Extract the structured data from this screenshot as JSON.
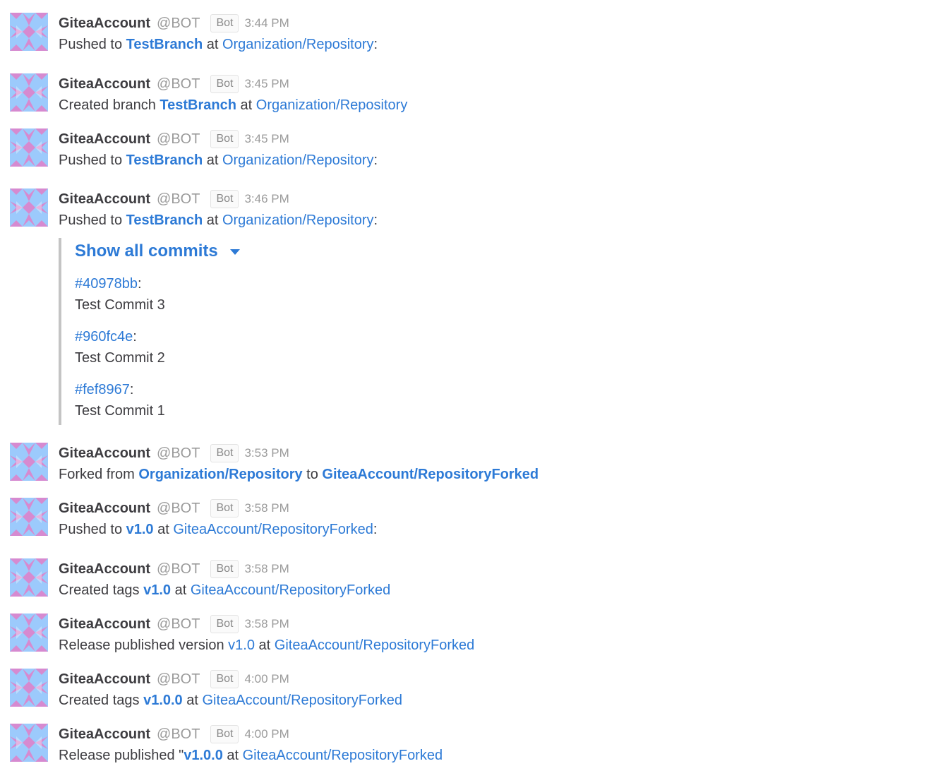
{
  "messages": [
    {
      "username": "GiteaAccount",
      "handle": "@BOT",
      "badge": "Bot",
      "time": "3:44 PM",
      "parts": [
        {
          "t": "Pushed to "
        },
        {
          "t": "TestBranch",
          "link": true,
          "bold": true
        },
        {
          "t": " at "
        },
        {
          "t": "Organization/Repository",
          "link": true
        },
        {
          "t": ":"
        }
      ]
    },
    {
      "username": "GiteaAccount",
      "handle": "@BOT",
      "badge": "Bot",
      "time": "3:45 PM",
      "parts": [
        {
          "t": "Created branch "
        },
        {
          "t": "TestBranch",
          "link": true,
          "bold": true
        },
        {
          "t": " at "
        },
        {
          "t": "Organization/Repository",
          "link": true
        }
      ]
    },
    {
      "username": "GiteaAccount",
      "handle": "@BOT",
      "badge": "Bot",
      "time": "3:45 PM",
      "parts": [
        {
          "t": "Pushed to "
        },
        {
          "t": "TestBranch",
          "link": true,
          "bold": true
        },
        {
          "t": " at "
        },
        {
          "t": "Organization/Repository",
          "link": true
        },
        {
          "t": ":"
        }
      ]
    },
    {
      "username": "GiteaAccount",
      "handle": "@BOT",
      "badge": "Bot",
      "time": "3:46 PM",
      "parts": [
        {
          "t": "Pushed to "
        },
        {
          "t": "TestBranch",
          "link": true,
          "bold": true
        },
        {
          "t": " at "
        },
        {
          "t": "Organization/Repository",
          "link": true
        },
        {
          "t": ":"
        }
      ]
    },
    {
      "username": "GiteaAccount",
      "handle": "@BOT",
      "badge": "Bot",
      "time": "3:53 PM",
      "parts": [
        {
          "t": "Forked from "
        },
        {
          "t": "Organization/Repository",
          "link": true,
          "bold": true
        },
        {
          "t": " to "
        },
        {
          "t": "GiteaAccount/RepositoryForked",
          "link": true,
          "bold": true
        }
      ]
    },
    {
      "username": "GiteaAccount",
      "handle": "@BOT",
      "badge": "Bot",
      "time": "3:58 PM",
      "parts": [
        {
          "t": "Pushed to "
        },
        {
          "t": "v1.0",
          "link": true,
          "bold": true
        },
        {
          "t": " at "
        },
        {
          "t": "GiteaAccount/RepositoryForked",
          "link": true
        },
        {
          "t": ":"
        }
      ]
    },
    {
      "username": "GiteaAccount",
      "handle": "@BOT",
      "badge": "Bot",
      "time": "3:58 PM",
      "parts": [
        {
          "t": "Created tags "
        },
        {
          "t": "v1.0",
          "link": true,
          "bold": true
        },
        {
          "t": " at "
        },
        {
          "t": "GiteaAccount/RepositoryForked",
          "link": true
        }
      ]
    },
    {
      "username": "GiteaAccount",
      "handle": "@BOT",
      "badge": "Bot",
      "time": "3:58 PM",
      "parts": [
        {
          "t": "Release published version "
        },
        {
          "t": "v1.0",
          "link": true
        },
        {
          "t": " at "
        },
        {
          "t": "GiteaAccount/RepositoryForked",
          "link": true
        }
      ]
    },
    {
      "username": "GiteaAccount",
      "handle": "@BOT",
      "badge": "Bot",
      "time": "4:00 PM",
      "parts": [
        {
          "t": "Created tags "
        },
        {
          "t": "v1.0.0",
          "link": true,
          "bold": true
        },
        {
          "t": " at "
        },
        {
          "t": "GiteaAccount/RepositoryForked",
          "link": true
        }
      ]
    },
    {
      "username": "GiteaAccount",
      "handle": "@BOT",
      "badge": "Bot",
      "time": "4:00 PM",
      "parts": [
        {
          "t": "Release published \""
        },
        {
          "t": "v1.0.0",
          "link": true,
          "bold": true
        },
        {
          "t": " at "
        },
        {
          "t": "GiteaAccount/RepositoryForked",
          "link": true
        }
      ]
    }
  ],
  "commits_block": {
    "toggle_label": "Show all commits",
    "commits": [
      {
        "hash": "#40978bb",
        "message": "Test Commit 3"
      },
      {
        "hash": "#960fc4e",
        "message": "Test Commit 2"
      },
      {
        "hash": "#fef8967",
        "message": "Test Commit 1"
      }
    ]
  },
  "colors": {
    "link": "#2d7ad6",
    "avatar_blue": "#9ccafc",
    "avatar_pink": "#d68ad0"
  },
  "icons": {
    "avatar": "identicon-avatar",
    "toggle": "caret-down-icon"
  }
}
